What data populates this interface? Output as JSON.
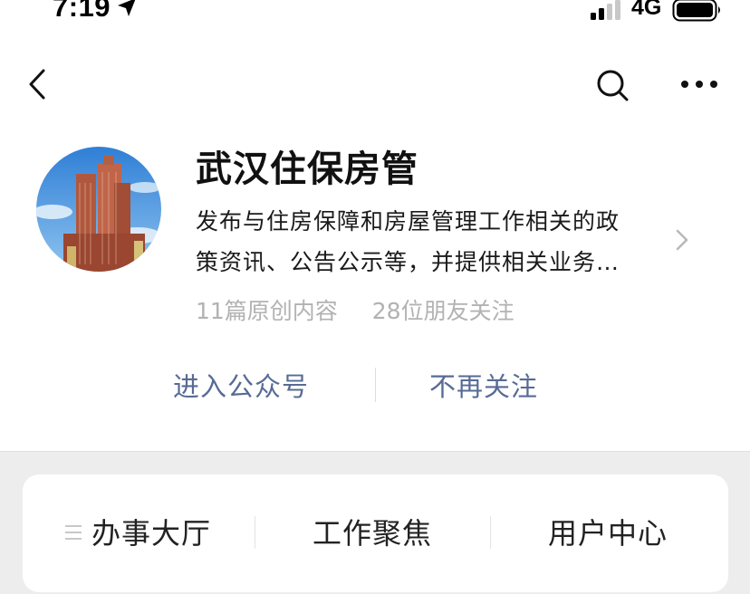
{
  "status_bar": {
    "time": "7:19",
    "network": "4G"
  },
  "nav": {
    "back_icon": "chevron-left-icon",
    "search_icon": "search-icon",
    "more_icon": "more-horizontal-icon"
  },
  "account": {
    "name": "武汉住保房管",
    "description_line1": "发布与住房保障和房屋管理工作相关的政",
    "description_line2": "策资讯、公告公示等，并提供相关业务…",
    "original_count": "11篇原创内容",
    "friends_following": "28位朋友关注"
  },
  "actions": {
    "enter_label": "进入公众号",
    "unfollow_label": "不再关注"
  },
  "menu": {
    "items": [
      {
        "label": "办事大厅"
      },
      {
        "label": "工作聚焦"
      },
      {
        "label": "用户中心"
      }
    ]
  },
  "colors": {
    "link_blue": "#576b95",
    "gray_text": "#b2b2b2",
    "background_gray": "#ededed"
  }
}
